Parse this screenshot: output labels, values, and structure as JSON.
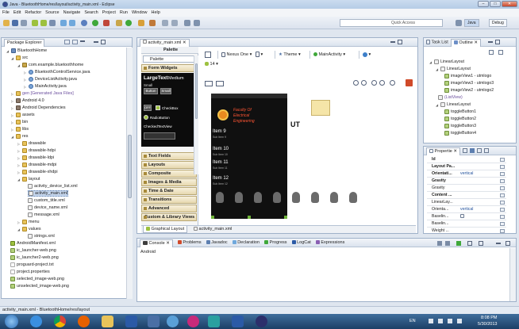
{
  "window": {
    "title": "Java - BluetoothHome/res/layout/activity_main.xml - Eclipse",
    "buttons": [
      "–",
      "□",
      "✕"
    ]
  },
  "menu": [
    "File",
    "Edit",
    "Refactor",
    "Source",
    "Navigate",
    "Search",
    "Project",
    "Run",
    "Window",
    "Help"
  ],
  "toolbar": {
    "quick_access": "Quick Access",
    "perspective_java": "Java",
    "perspective_debug": "Debug"
  },
  "package_explorer": {
    "tab": "Package Explorer",
    "items": [
      "BluetoothHome",
      "src",
      "com.example.bluetoothhome",
      "BluetoothControlService.java",
      "DeviceListActivity.java",
      "MainActivity.java",
      "gen [Generated Java Files]",
      "Android 4.0",
      "Android Dependencies",
      "assets",
      "bin",
      "libs",
      "res",
      "drawable",
      "drawable-hdpi",
      "drawable-ldpi",
      "drawable-mdpi",
      "drawable-xhdpi",
      "layout",
      "activity_device_list.xml",
      "activity_main.xml",
      "custom_title.xml",
      "device_name.xml",
      "message.xml",
      "menu",
      "values",
      "strings.xml",
      "AndroidManifest.xml",
      "ic_launcher-web.png",
      "ic_launcher2-web.png",
      "proguard-project.txt",
      "project.properties",
      "selected_image-web.png",
      "unselected_image-web.png"
    ]
  },
  "editor": {
    "tab": "activity_main.xml",
    "palette_title": "Palette",
    "palette_dropdown": "Palette",
    "palette_categories": [
      "Form Widgets",
      "Text Fields",
      "Layouts",
      "Composite",
      "Images & Media",
      "Time & Date",
      "Transitions",
      "Advanced",
      "Custom & Library Views"
    ],
    "form_widgets": {
      "large": "Large",
      "medium": "Medium",
      "small": "Small",
      "button": "Button",
      "checkbox": "CheckBox",
      "radio": "RadioButton",
      "checked_text": "CheckedTextView",
      "toggle_off": "OFF"
    },
    "config": {
      "device": "Nexus One",
      "theme": "Theme",
      "activity": "MainActivity",
      "api": "14"
    },
    "canvas": {
      "app_title_lines": [
        "Faculty Of",
        "Electrical",
        "Engineering"
      ],
      "side_text": "UT",
      "list_items": [
        {
          "title": "Item 9",
          "sub": "Sub Item 9"
        },
        {
          "title": "Item 10",
          "sub": "Sub Item 10"
        },
        {
          "title": "Item 11",
          "sub": "Sub Item 11"
        },
        {
          "title": "Item 12",
          "sub": "Sub Item 12"
        }
      ]
    },
    "bottom_tabs": [
      "Graphical Layout",
      "activity_main.xml"
    ]
  },
  "outline": {
    "tabs": [
      "Task List",
      "Outline"
    ],
    "nodes": [
      "LinearLayout",
      "LinearLayout",
      "imageView1 - utmlogo",
      "imageView3 - utmlogo3",
      "imageView2 - utmlogo2",
      "(ListView)",
      "LinearLayout",
      "toggleButton1",
      "toggleButton2",
      "toggleButton3",
      "toggleButton4"
    ]
  },
  "properties": {
    "tab": "Propertie",
    "rows": [
      {
        "k": "Id",
        "v": ""
      },
      {
        "k": "Layout Pa...",
        "v": ""
      },
      {
        "k": "Orientati...",
        "v": "vertical"
      },
      {
        "k": "Gravity",
        "v": ""
      },
      {
        "k": "Gravity",
        "v": ""
      },
      {
        "k": "Content ...",
        "v": ""
      },
      {
        "k": "LinearLay...",
        "v": ""
      },
      {
        "k": "Orienta...",
        "v": "vertical"
      },
      {
        "k": "Baselin...",
        "v": ""
      },
      {
        "k": "Baselin...",
        "v": ""
      },
      {
        "k": "Weight ...",
        "v": ""
      }
    ]
  },
  "console": {
    "tabs": [
      "Console",
      "Problems",
      "Javadoc",
      "Declaration",
      "Progress",
      "LogCat",
      "Expressions"
    ],
    "content": "Android"
  },
  "status": {
    "text": "activity_main.xml - BluetoothHome/res/layout"
  },
  "taskbar": {
    "lang": "EN",
    "time": "8:08 PM",
    "date": "5/30/2013"
  },
  "colors": {
    "titlebar": "#b5cce6",
    "taskbar": "#1c3f66",
    "selection": "#c7d8ef",
    "palette_cat": "#e7d8b0",
    "accent_green": "#6fb43a"
  }
}
